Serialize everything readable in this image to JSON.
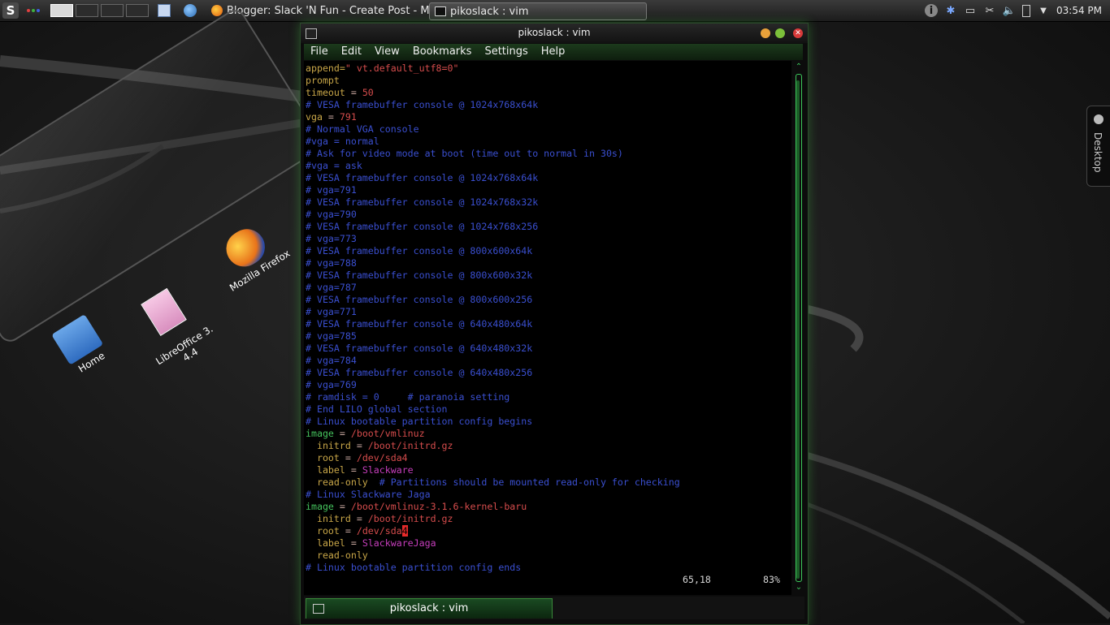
{
  "panel": {
    "kmenu_glyph": "S",
    "pager_count": 4,
    "active_desktop": 1,
    "tasks": [
      {
        "label": "Blogger: Slack 'N Fun - Create Post - M",
        "icon": "firefox-icon"
      },
      {
        "label": "pikoslack : vim",
        "icon": "terminal-icon"
      }
    ],
    "clock": "03:54 PM",
    "tray_icons": [
      "info-icon",
      "bluetooth-icon",
      "network-icon",
      "klipper-icon",
      "volume-icon",
      "battery-icon",
      "expand-arrow-icon"
    ]
  },
  "desktop": {
    "icons": [
      {
        "label": "Home"
      },
      {
        "label": "LibreOffice 3.\n4.4"
      },
      {
        "label": "Mozilla Firefox"
      }
    ],
    "toolbox_label": "Desktop"
  },
  "window": {
    "title": "pikoslack : vim",
    "menu": [
      "File",
      "Edit",
      "View",
      "Bookmarks",
      "Settings",
      "Help"
    ],
    "status_pos": "65,18",
    "status_pct": "83%",
    "tab_label": "pikoslack : vim",
    "lines": [
      [
        [
          "c-key",
          "append="
        ],
        [
          "c-val",
          "\" vt.default_utf8=0\""
        ]
      ],
      [
        [
          "c-key",
          "prompt"
        ]
      ],
      [
        [
          "c-key",
          "timeout"
        ],
        [
          "c-plain",
          " = "
        ],
        [
          "c-val",
          "50"
        ]
      ],
      [
        [
          "c-comment",
          "# VESA framebuffer console @ 1024x768x64k"
        ]
      ],
      [
        [
          "c-key",
          "vga"
        ],
        [
          "c-plain",
          " = "
        ],
        [
          "c-val",
          "791"
        ]
      ],
      [
        [
          "c-comment",
          "# Normal VGA console"
        ]
      ],
      [
        [
          "c-comment",
          "#vga = normal"
        ]
      ],
      [
        [
          "c-comment",
          "# Ask for video mode at boot (time out to normal in 30s)"
        ]
      ],
      [
        [
          "c-comment",
          "#vga = ask"
        ]
      ],
      [
        [
          "c-comment",
          "# VESA framebuffer console @ 1024x768x64k"
        ]
      ],
      [
        [
          "c-comment",
          "# vga=791"
        ]
      ],
      [
        [
          "c-comment",
          "# VESA framebuffer console @ 1024x768x32k"
        ]
      ],
      [
        [
          "c-comment",
          "# vga=790"
        ]
      ],
      [
        [
          "c-comment",
          "# VESA framebuffer console @ 1024x768x256"
        ]
      ],
      [
        [
          "c-comment",
          "# vga=773"
        ]
      ],
      [
        [
          "c-comment",
          "# VESA framebuffer console @ 800x600x64k"
        ]
      ],
      [
        [
          "c-comment",
          "# vga=788"
        ]
      ],
      [
        [
          "c-comment",
          "# VESA framebuffer console @ 800x600x32k"
        ]
      ],
      [
        [
          "c-comment",
          "# vga=787"
        ]
      ],
      [
        [
          "c-comment",
          "# VESA framebuffer console @ 800x600x256"
        ]
      ],
      [
        [
          "c-comment",
          "# vga=771"
        ]
      ],
      [
        [
          "c-comment",
          "# VESA framebuffer console @ 640x480x64k"
        ]
      ],
      [
        [
          "c-comment",
          "# vga=785"
        ]
      ],
      [
        [
          "c-comment",
          "# VESA framebuffer console @ 640x480x32k"
        ]
      ],
      [
        [
          "c-comment",
          "# vga=784"
        ]
      ],
      [
        [
          "c-comment",
          "# VESA framebuffer console @ 640x480x256"
        ]
      ],
      [
        [
          "c-comment",
          "# vga=769"
        ]
      ],
      [
        [
          "c-comment",
          "# ramdisk = 0     # paranoia setting"
        ]
      ],
      [
        [
          "c-comment",
          "# End LILO global section"
        ]
      ],
      [
        [
          "c-comment",
          "# Linux bootable partition config begins"
        ]
      ],
      [
        [
          "c-img",
          "image"
        ],
        [
          "c-plain",
          " = "
        ],
        [
          "c-val",
          "/boot/vmlinuz"
        ]
      ],
      [
        [
          "c-key",
          "  initrd"
        ],
        [
          "c-plain",
          " = "
        ],
        [
          "c-val",
          "/boot/initrd.gz"
        ]
      ],
      [
        [
          "c-key",
          "  root"
        ],
        [
          "c-plain",
          " = "
        ],
        [
          "c-val",
          "/dev/sda4"
        ]
      ],
      [
        [
          "c-key",
          "  label"
        ],
        [
          "c-plain",
          " = "
        ],
        [
          "c-mag",
          "Slackware"
        ]
      ],
      [
        [
          "c-key",
          "  read-only"
        ],
        [
          "c-comment",
          "  # Partitions should be mounted read-only for checking"
        ]
      ],
      [
        [
          "c-comment",
          "# Linux Slackware Jaga"
        ]
      ],
      [
        [
          "c-img",
          "image"
        ],
        [
          "c-plain",
          " = "
        ],
        [
          "c-val",
          "/boot/vmlinuz-3.1.6-kernel-baru"
        ]
      ],
      [
        [
          "c-key",
          "  initrd"
        ],
        [
          "c-plain",
          " = "
        ],
        [
          "c-val",
          "/boot/initrd.gz"
        ]
      ],
      [
        [
          "c-key",
          "  root"
        ],
        [
          "c-plain",
          " = "
        ],
        [
          "c-val",
          "/dev/sda"
        ],
        [
          "cursor",
          "4"
        ]
      ],
      [
        [
          "c-key",
          "  label"
        ],
        [
          "c-plain",
          " = "
        ],
        [
          "c-mag",
          "SlackwareJaga"
        ]
      ],
      [
        [
          "c-key",
          "  read-only"
        ]
      ],
      [
        [
          "c-comment",
          "# Linux bootable partition config ends"
        ]
      ]
    ]
  },
  "colors": {
    "accent_green": "#3cc85a",
    "comment_blue": "#3a4fd0",
    "value_red": "#d54c4c",
    "key_yellow": "#c8a648"
  }
}
